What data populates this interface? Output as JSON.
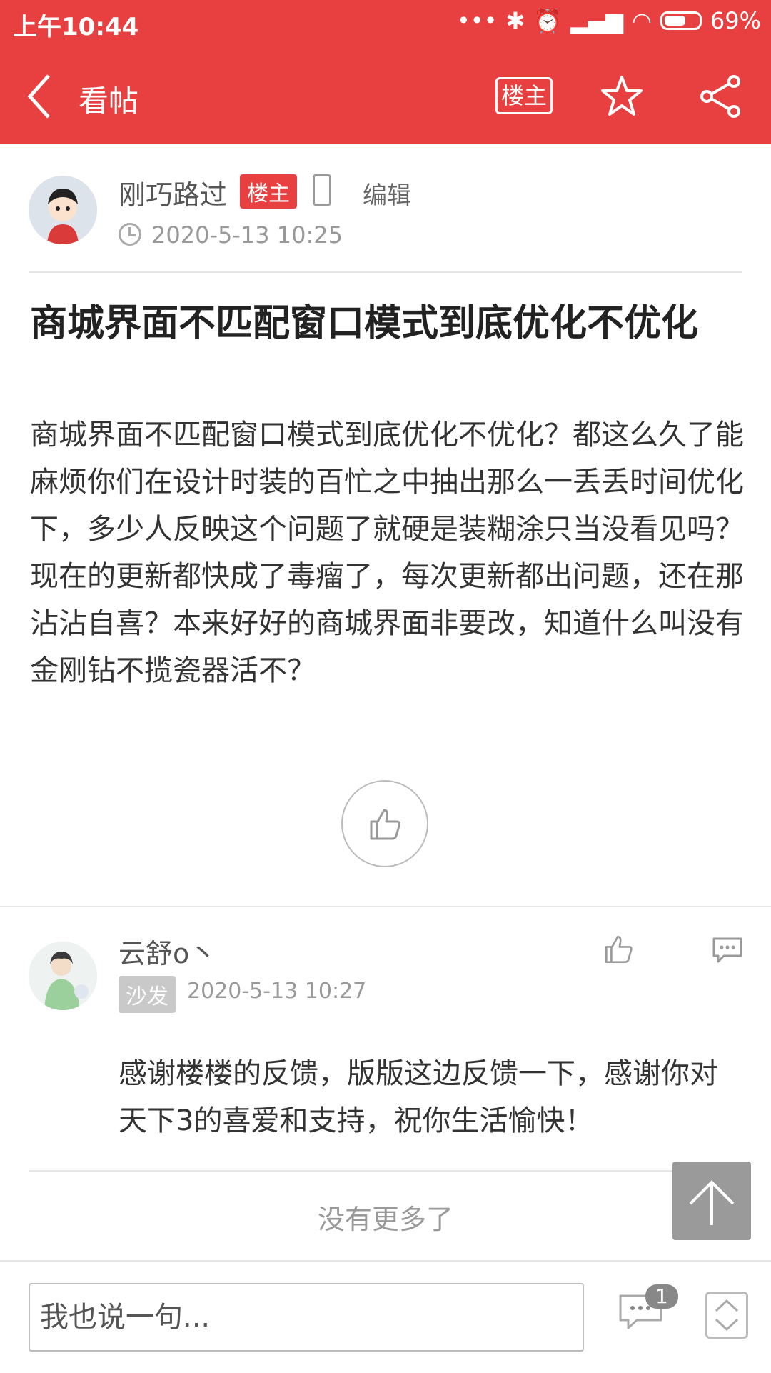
{
  "status_bar": {
    "time": "上午10:44",
    "battery": "69%",
    "battery_level": 0.69
  },
  "navbar": {
    "title": "看帖",
    "owner_filter_label": "楼主"
  },
  "post": {
    "author": "刚巧路过",
    "owner_badge": "楼主",
    "edit_label": "编辑",
    "time": "2020-5-13 10:25",
    "title": "商城界面不匹配窗口模式到底优化不优化",
    "body": "商城界面不匹配窗口模式到底优化不优化？都这么久了能麻烦你们在设计时装的百忙之中抽出那么一丢丢时间优化下，多少人反映这个问题了就硬是装糊涂只当没看见吗？现在的更新都快成了毒瘤了，每次更新都出问题，还在那沾沾自喜？本来好好的商城界面非要改，知道什么叫没有金刚钻不揽瓷器活不？"
  },
  "reply": {
    "author": "云舒o丶",
    "floor_label": "沙发",
    "time": "2020-5-13 10:27",
    "body": "感谢楼楼的反馈，版版这边反馈一下，感谢你对天下3的喜爱和支持，祝你生活愉快！"
  },
  "footer": {
    "no_more": "没有更多了",
    "input_placeholder": "我也说一句...",
    "comment_count": "1"
  },
  "colors": {
    "accent": "#e84040",
    "muted": "#999999",
    "divider": "#e6e6e6"
  },
  "icons": [
    "back-arrow-icon",
    "star-icon",
    "share-icon",
    "phone-icon",
    "clock-icon",
    "thumbs-up-icon",
    "comment-icon",
    "arrow-up-icon",
    "page-nav-icon",
    "bluetooth-icon",
    "alarm-icon",
    "signal-icon",
    "wifi-icon",
    "battery-icon"
  ]
}
